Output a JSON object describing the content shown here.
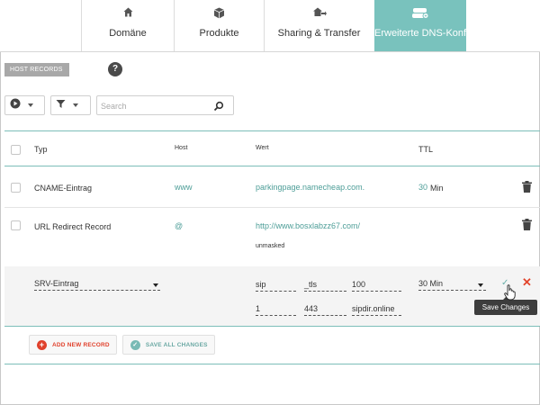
{
  "tabs": [
    {
      "label": "Domäne",
      "icon": "home-icon"
    },
    {
      "label": "Produkte",
      "icon": "box-icon"
    },
    {
      "label": "Sharing & Transfer",
      "icon": "share-icon"
    },
    {
      "label": "Erweiterte DNS-Konfiguration",
      "icon": "server-icon"
    }
  ],
  "section": {
    "title": "HOST RECORDS",
    "help": "?"
  },
  "toolbar": {
    "search_placeholder": "Search"
  },
  "table": {
    "headers": {
      "type": "Typ",
      "host": "Host",
      "value": "Wert",
      "ttl": "TTL"
    },
    "rows": [
      {
        "type": "CNAME-Eintrag",
        "host": "www",
        "value": "parkingpage.namecheap.com.",
        "ttl_value": "30",
        "ttl_unit": "Min"
      },
      {
        "type": "URL Redirect Record",
        "host": "@",
        "value": "http://www.bosxlabzz67.com/",
        "note": "unmasked"
      }
    ],
    "edit_row": {
      "type": "SRV-Eintrag",
      "service": "sip",
      "protocol": "_tls",
      "priority": "100",
      "weight": "1",
      "port": "443",
      "target": "sipdir.online",
      "ttl": "30 Min",
      "tooltip": "Save Changes"
    }
  },
  "actions": {
    "add": "ADD NEW RECORD",
    "save_all": "SAVE ALL CHANGES"
  },
  "colors": {
    "accent": "#79c2bd",
    "link": "#4e9e98",
    "danger": "#e0412c"
  }
}
